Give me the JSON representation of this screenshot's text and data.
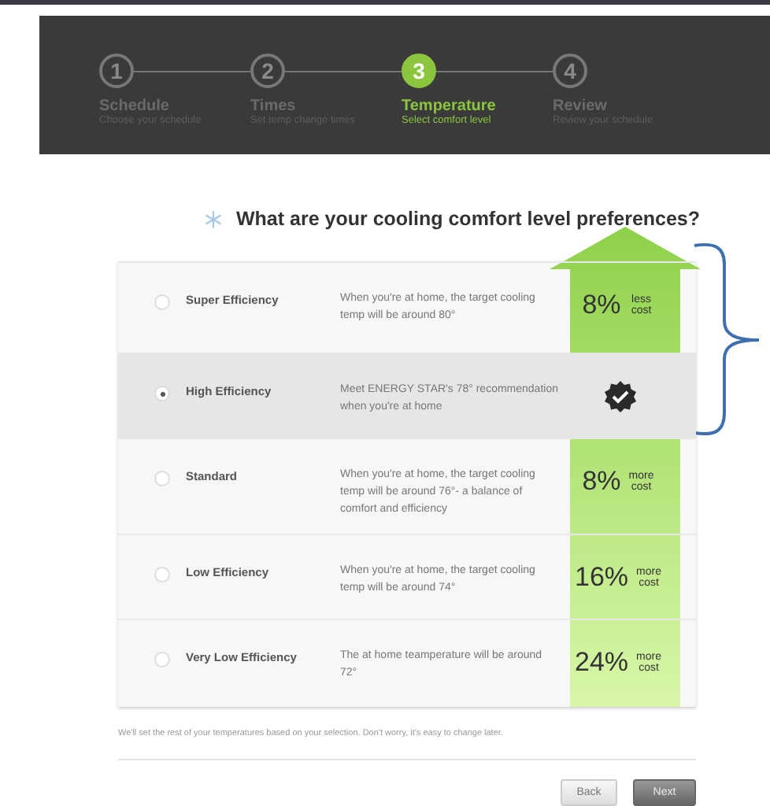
{
  "steps": [
    {
      "number": "1",
      "title": "Schedule",
      "subtitle": "Choose your schedule",
      "selected": false
    },
    {
      "number": "2",
      "title": "Times",
      "subtitle": "Set temp change times",
      "selected": false
    },
    {
      "number": "3",
      "title": "Temperature",
      "subtitle": "Select comfort level",
      "selected": true
    },
    {
      "number": "4",
      "title": "Review",
      "subtitle": "Review your schedule",
      "selected": false
    }
  ],
  "question": "What are your cooling comfort level preferences?",
  "options": [
    {
      "name": "Super Efficiency",
      "description": "When you're at home, the target cooling temp will be around 80°",
      "selected": false,
      "cost": {
        "kind": "percent",
        "value": "8%",
        "note": "less cost"
      }
    },
    {
      "name": "High Efficiency",
      "description": "Meet ENERGY STAR's 78° recommendation when you're at home",
      "selected": true,
      "cost": {
        "kind": "badge"
      }
    },
    {
      "name": "Standard",
      "description": "When you're at home, the target cooling temp will be around 76°- a balance of comfort and efficiency",
      "selected": false,
      "cost": {
        "kind": "percent",
        "value": "8%",
        "note": "more cost"
      }
    },
    {
      "name": "Low Efficiency",
      "description": "When you're at home, the target cooling temp will be around 74°",
      "selected": false,
      "cost": {
        "kind": "percent",
        "value": "16%",
        "note": "more cost"
      }
    },
    {
      "name": "Very Low Efficiency",
      "description": "The at home teamperature will be around 72°",
      "selected": false,
      "cost": {
        "kind": "percent",
        "value": "24%",
        "note": "more cost"
      }
    }
  ],
  "footnote": "We'll set the rest of your temperatures based on your selection. Don't worry, it's easy to change later.",
  "buttons": [
    {
      "label": "Back",
      "kind": "secondary"
    },
    {
      "label": "Next",
      "kind": "primary"
    }
  ]
}
